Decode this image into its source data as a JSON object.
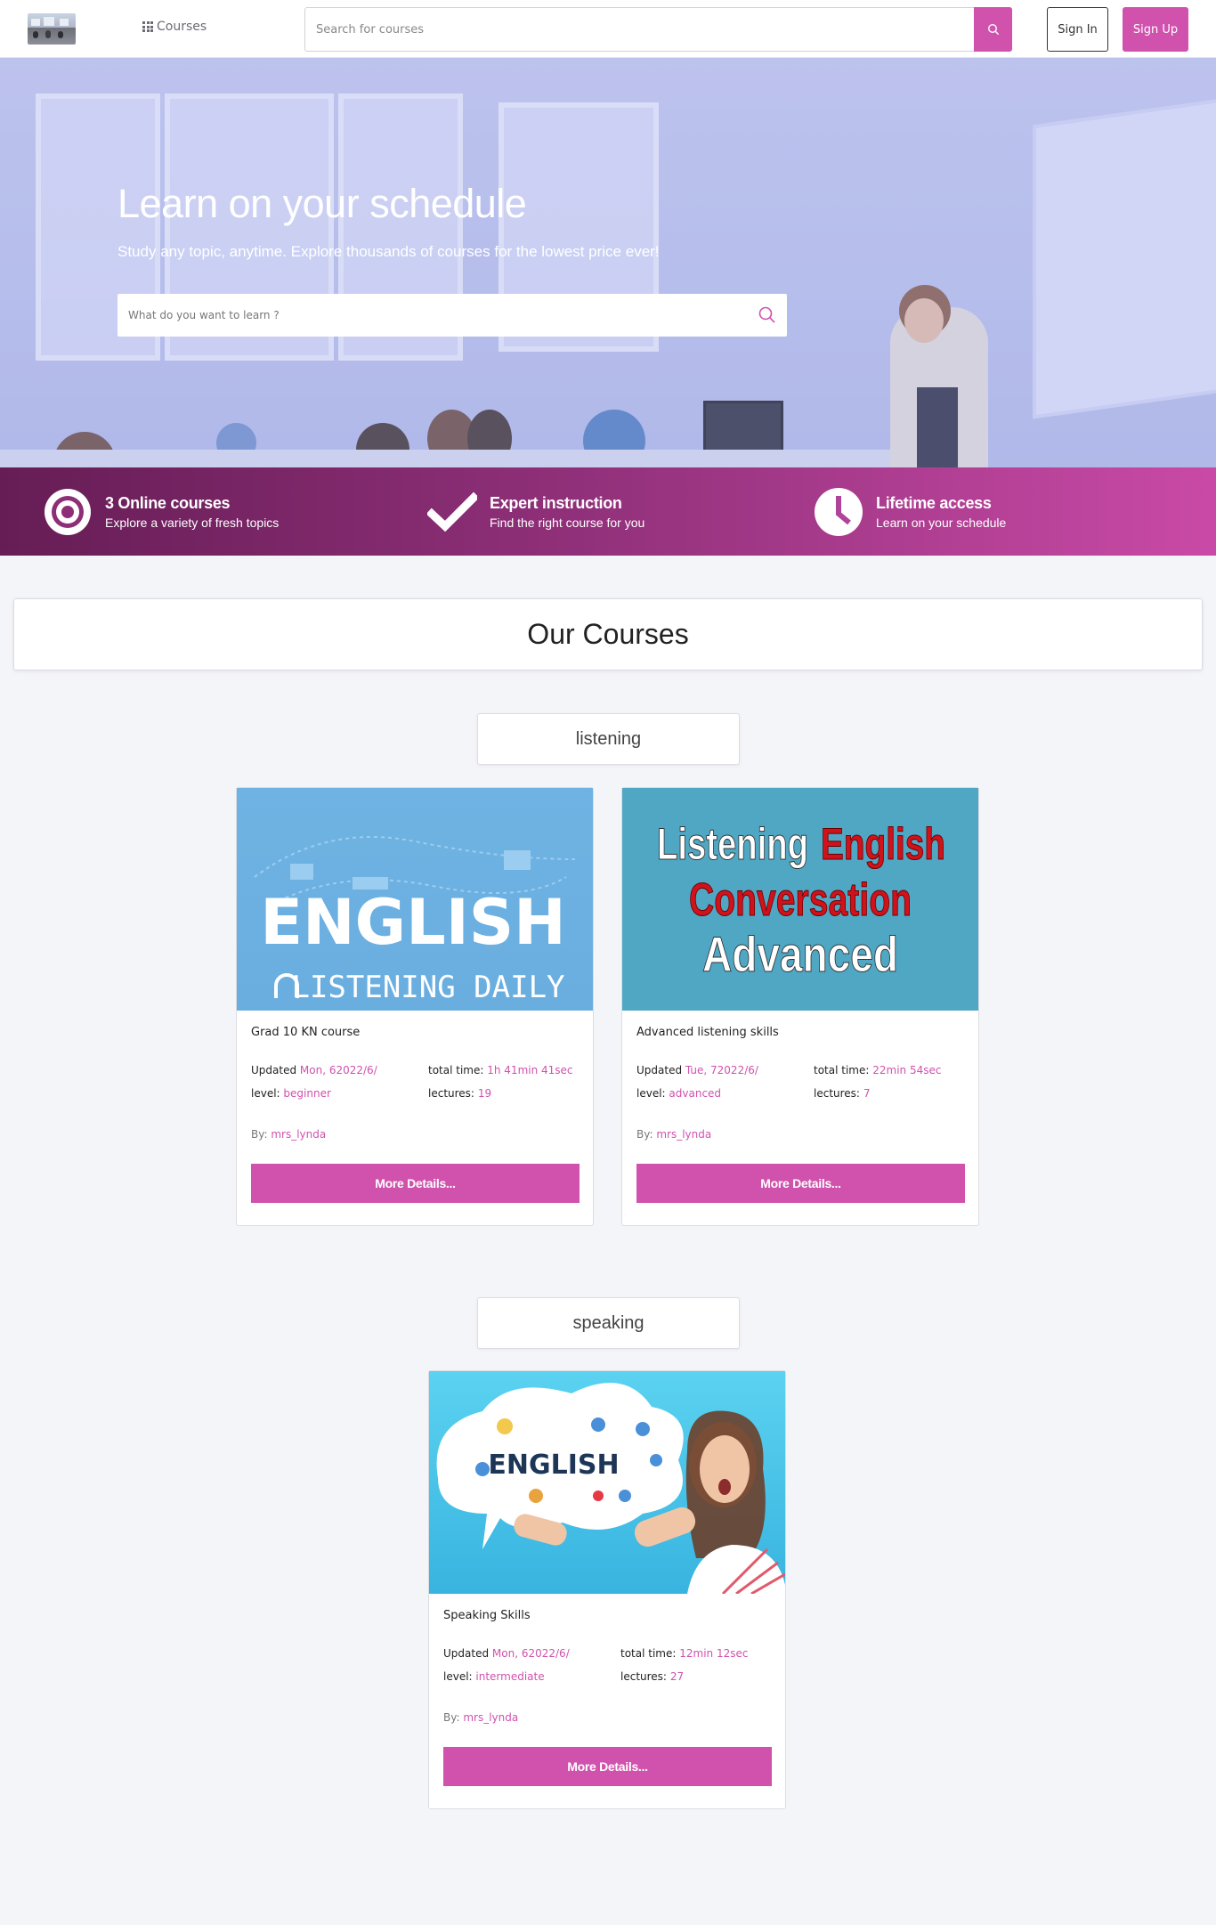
{
  "nav": {
    "courses_label": "Courses",
    "search_placeholder": "Search for courses",
    "signin_label": "Sign In",
    "signup_label": "Sign Up"
  },
  "hero": {
    "title": "Learn on your schedule",
    "subtitle": "Study any topic, anytime. Explore thousands of courses for the lowest price ever!",
    "search_placeholder": "What do you want to learn ?"
  },
  "features": [
    {
      "title": "3 Online courses",
      "subtitle": "Explore a variety of fresh topics",
      "icon": "target-icon"
    },
    {
      "title": "Expert instruction",
      "subtitle": "Find the right course for you",
      "icon": "check-icon"
    },
    {
      "title": "Lifetime access",
      "subtitle": "Learn on your schedule",
      "icon": "clock-icon"
    }
  ],
  "section_title": "Our Courses",
  "categories": [
    {
      "name": "listening",
      "courses": [
        {
          "image_text": [
            "ENGLISH",
            "LISTENING DAILY"
          ],
          "title": "Grad 10 KN course",
          "updated_label": "Updated",
          "updated": "Mon, 62022/6/",
          "total_label": "total time:",
          "total": "1h 41min 41sec",
          "level_label": "level:",
          "level": "beginner",
          "lectures_label": "lectures:",
          "lectures": "19",
          "by_label": "By:",
          "by": "mrs_lynda",
          "button": "More Details..."
        },
        {
          "image_text": [
            "Listening",
            "English",
            "Conversation",
            "Advanced"
          ],
          "title": "Advanced listening skills",
          "updated_label": "Updated",
          "updated": "Tue, 72022/6/",
          "total_label": "total time:",
          "total": "22min 54sec",
          "level_label": "level:",
          "level": "advanced",
          "lectures_label": "lectures:",
          "lectures": "7",
          "by_label": "By:",
          "by": "mrs_lynda",
          "button": "More Details..."
        }
      ]
    },
    {
      "name": "speaking",
      "courses": [
        {
          "image_text": [
            "ENGLISH"
          ],
          "title": "Speaking Skills",
          "updated_label": "Updated",
          "updated": "Mon, 62022/6/",
          "total_label": "total time:",
          "total": "12min 12sec",
          "level_label": "level:",
          "level": "intermediate",
          "lectures_label": "lectures:",
          "lectures": "27",
          "by_label": "By:",
          "by": "mrs_lynda",
          "button": "More Details..."
        }
      ]
    }
  ],
  "colors": {
    "accent": "#d052ad",
    "strip_start": "#661d55",
    "strip_end": "#c94aa6"
  }
}
